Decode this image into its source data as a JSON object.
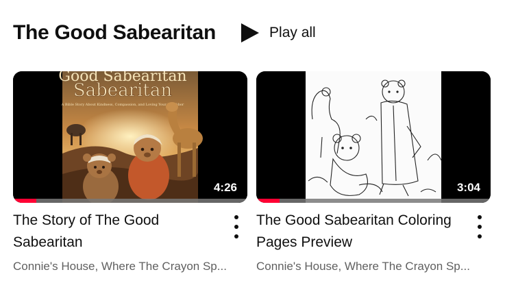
{
  "shelf": {
    "title": "The Good Sabearitan",
    "play_all_label": "Play all",
    "play_icon": "play-icon"
  },
  "videos": [
    {
      "title": "The Story of The Good Sabearitan",
      "duration": "4:26",
      "channel": "Connie's House, Where The Crayon Sp...",
      "progress": 0.1,
      "thumbnail": {
        "title_art": "Good Sabearitan",
        "subtitle_art": "A Bible Story About Kindness, Compassion, and Loving Your Neighbor"
      }
    },
    {
      "title": "The Good Sabearitan Coloring Pages Preview",
      "duration": "3:04",
      "channel": "Connie's House, Where The Crayon Sp...",
      "progress": 0.1
    }
  ],
  "colors": {
    "progress": "#ff0033",
    "text_primary": "#0f0f0f",
    "text_secondary": "#606060"
  }
}
